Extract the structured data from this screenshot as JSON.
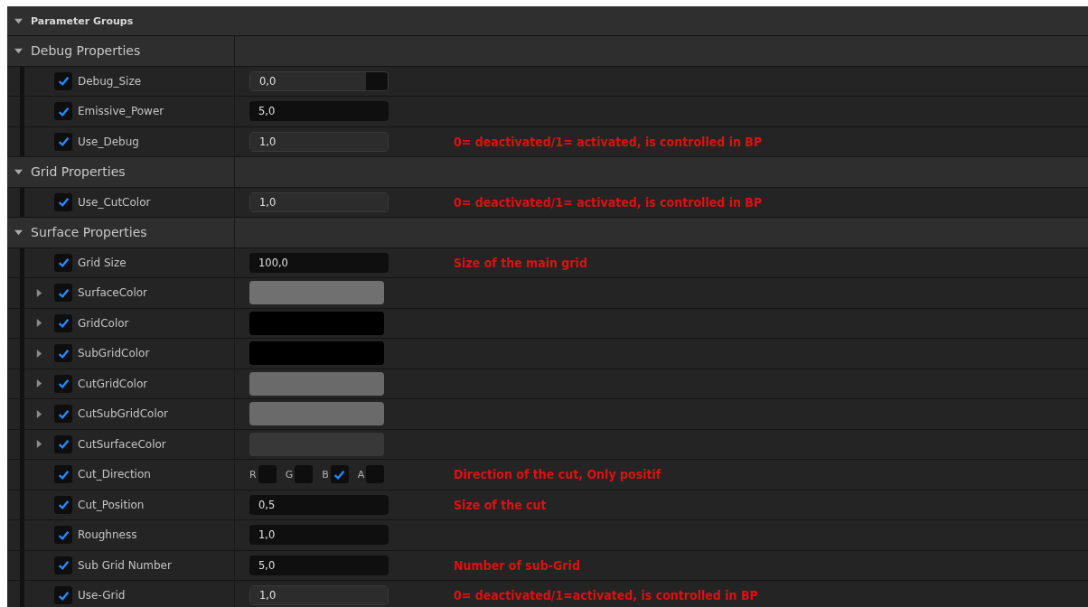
{
  "panel": {
    "title": "Parameter Groups",
    "expanded": true,
    "groups": [
      {
        "title": "Debug Properties",
        "expanded": true,
        "params": [
          {
            "name": "Debug_Size",
            "enabled": true,
            "kind": "slider",
            "value": "0,0",
            "level": 0.84
          },
          {
            "name": "Emissive_Power",
            "enabled": true,
            "kind": "number",
            "value": "5,0"
          },
          {
            "name": "Use_Debug",
            "enabled": true,
            "kind": "slider",
            "value": "1,0",
            "level": 1,
            "note": "0= deactivated/1= activated, is controlled in BP"
          }
        ]
      },
      {
        "title": "Grid Properties",
        "expanded": true,
        "params": [
          {
            "name": "Use_CutColor",
            "enabled": true,
            "kind": "slider",
            "value": "1,0",
            "level": 1,
            "note": "0= deactivated/1= activated, is controlled in BP"
          }
        ]
      },
      {
        "title": "Surface Properties",
        "expanded": true,
        "params": [
          {
            "name": "Grid Size",
            "enabled": true,
            "kind": "number",
            "value": "100,0",
            "note": "Size of the main grid"
          },
          {
            "name": "SurfaceColor",
            "enabled": true,
            "kind": "color",
            "expanded": false,
            "color": "#707070"
          },
          {
            "name": "GridColor",
            "enabled": true,
            "kind": "color",
            "expanded": false,
            "color": "#000000"
          },
          {
            "name": "SubGridColor",
            "enabled": true,
            "kind": "color",
            "expanded": false,
            "color": "#000000"
          },
          {
            "name": "CutGridColor",
            "enabled": true,
            "kind": "color",
            "expanded": false,
            "color": "#6a6a6a"
          },
          {
            "name": "CutSubGridColor",
            "enabled": true,
            "kind": "color",
            "expanded": false,
            "color": "#6a6a6a"
          },
          {
            "name": "CutSurfaceColor",
            "enabled": true,
            "kind": "color",
            "expanded": false,
            "color": "#383838"
          },
          {
            "name": "Cut_Direction",
            "enabled": true,
            "kind": "channels",
            "channels": [
              {
                "label": "R",
                "checked": false
              },
              {
                "label": "G",
                "checked": false
              },
              {
                "label": "B",
                "checked": true
              },
              {
                "label": "A",
                "checked": false
              }
            ],
            "note": "Direction of the cut, Only positif"
          },
          {
            "name": "Cut_Position",
            "enabled": true,
            "kind": "number",
            "value": "0,5",
            "note": "Size of the cut"
          },
          {
            "name": "Roughness",
            "enabled": true,
            "kind": "number",
            "value": "1,0"
          },
          {
            "name": "Sub Grid Number",
            "enabled": true,
            "kind": "number",
            "value": "5,0",
            "note": "Number of sub-Grid"
          },
          {
            "name": "Use-Grid",
            "enabled": true,
            "kind": "slider",
            "value": "1,0",
            "level": 1,
            "note": "0= deactivated/1=activated, is controlled in BP"
          }
        ]
      }
    ]
  }
}
